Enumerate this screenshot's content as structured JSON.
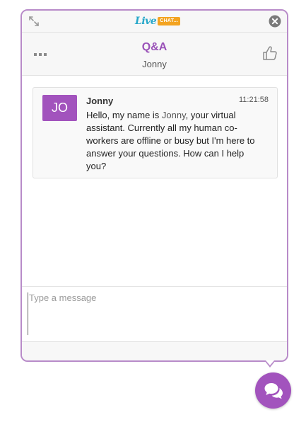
{
  "topbar": {
    "logo_live": "Live",
    "logo_chat": "CHAT..."
  },
  "header": {
    "title": "Q&A",
    "subtitle": "Jonny"
  },
  "message": {
    "avatar_initials": "JO",
    "sender": "Jonny",
    "time": "11:21:58",
    "text_before": "Hello, my name is ",
    "text_name": "Jonny",
    "text_after": ", your virtual assistant. Currently all my human co-workers are offline or busy but I'm here to answer your questions. How can I help you?"
  },
  "input": {
    "value": "",
    "placeholder": "Type a message"
  },
  "colors": {
    "accent": "#a253bd",
    "border": "#b88bc9",
    "logo_blue": "#26a7c9",
    "logo_orange": "#f3a320"
  },
  "icons": [
    "expand-icon",
    "close-icon",
    "more-dots-icon",
    "thumbs-up-icon",
    "chat-bubbles-icon"
  ]
}
